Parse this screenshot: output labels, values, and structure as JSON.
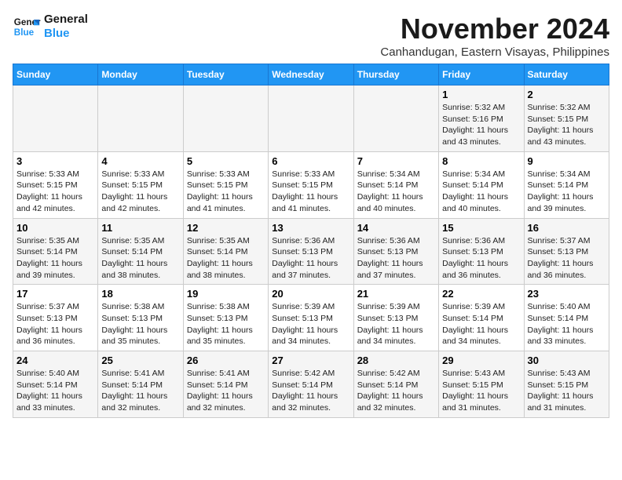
{
  "logo": {
    "line1": "General",
    "line2": "Blue"
  },
  "title": "November 2024",
  "location": "Canhandugan, Eastern Visayas, Philippines",
  "days_of_week": [
    "Sunday",
    "Monday",
    "Tuesday",
    "Wednesday",
    "Thursday",
    "Friday",
    "Saturday"
  ],
  "weeks": [
    [
      {
        "day": "",
        "info": ""
      },
      {
        "day": "",
        "info": ""
      },
      {
        "day": "",
        "info": ""
      },
      {
        "day": "",
        "info": ""
      },
      {
        "day": "",
        "info": ""
      },
      {
        "day": "1",
        "info": "Sunrise: 5:32 AM\nSunset: 5:16 PM\nDaylight: 11 hours\nand 43 minutes."
      },
      {
        "day": "2",
        "info": "Sunrise: 5:32 AM\nSunset: 5:15 PM\nDaylight: 11 hours\nand 43 minutes."
      }
    ],
    [
      {
        "day": "3",
        "info": "Sunrise: 5:33 AM\nSunset: 5:15 PM\nDaylight: 11 hours\nand 42 minutes."
      },
      {
        "day": "4",
        "info": "Sunrise: 5:33 AM\nSunset: 5:15 PM\nDaylight: 11 hours\nand 42 minutes."
      },
      {
        "day": "5",
        "info": "Sunrise: 5:33 AM\nSunset: 5:15 PM\nDaylight: 11 hours\nand 41 minutes."
      },
      {
        "day": "6",
        "info": "Sunrise: 5:33 AM\nSunset: 5:15 PM\nDaylight: 11 hours\nand 41 minutes."
      },
      {
        "day": "7",
        "info": "Sunrise: 5:34 AM\nSunset: 5:14 PM\nDaylight: 11 hours\nand 40 minutes."
      },
      {
        "day": "8",
        "info": "Sunrise: 5:34 AM\nSunset: 5:14 PM\nDaylight: 11 hours\nand 40 minutes."
      },
      {
        "day": "9",
        "info": "Sunrise: 5:34 AM\nSunset: 5:14 PM\nDaylight: 11 hours\nand 39 minutes."
      }
    ],
    [
      {
        "day": "10",
        "info": "Sunrise: 5:35 AM\nSunset: 5:14 PM\nDaylight: 11 hours\nand 39 minutes."
      },
      {
        "day": "11",
        "info": "Sunrise: 5:35 AM\nSunset: 5:14 PM\nDaylight: 11 hours\nand 38 minutes."
      },
      {
        "day": "12",
        "info": "Sunrise: 5:35 AM\nSunset: 5:14 PM\nDaylight: 11 hours\nand 38 minutes."
      },
      {
        "day": "13",
        "info": "Sunrise: 5:36 AM\nSunset: 5:13 PM\nDaylight: 11 hours\nand 37 minutes."
      },
      {
        "day": "14",
        "info": "Sunrise: 5:36 AM\nSunset: 5:13 PM\nDaylight: 11 hours\nand 37 minutes."
      },
      {
        "day": "15",
        "info": "Sunrise: 5:36 AM\nSunset: 5:13 PM\nDaylight: 11 hours\nand 36 minutes."
      },
      {
        "day": "16",
        "info": "Sunrise: 5:37 AM\nSunset: 5:13 PM\nDaylight: 11 hours\nand 36 minutes."
      }
    ],
    [
      {
        "day": "17",
        "info": "Sunrise: 5:37 AM\nSunset: 5:13 PM\nDaylight: 11 hours\nand 36 minutes."
      },
      {
        "day": "18",
        "info": "Sunrise: 5:38 AM\nSunset: 5:13 PM\nDaylight: 11 hours\nand 35 minutes."
      },
      {
        "day": "19",
        "info": "Sunrise: 5:38 AM\nSunset: 5:13 PM\nDaylight: 11 hours\nand 35 minutes."
      },
      {
        "day": "20",
        "info": "Sunrise: 5:39 AM\nSunset: 5:13 PM\nDaylight: 11 hours\nand 34 minutes."
      },
      {
        "day": "21",
        "info": "Sunrise: 5:39 AM\nSunset: 5:13 PM\nDaylight: 11 hours\nand 34 minutes."
      },
      {
        "day": "22",
        "info": "Sunrise: 5:39 AM\nSunset: 5:14 PM\nDaylight: 11 hours\nand 34 minutes."
      },
      {
        "day": "23",
        "info": "Sunrise: 5:40 AM\nSunset: 5:14 PM\nDaylight: 11 hours\nand 33 minutes."
      }
    ],
    [
      {
        "day": "24",
        "info": "Sunrise: 5:40 AM\nSunset: 5:14 PM\nDaylight: 11 hours\nand 33 minutes."
      },
      {
        "day": "25",
        "info": "Sunrise: 5:41 AM\nSunset: 5:14 PM\nDaylight: 11 hours\nand 32 minutes."
      },
      {
        "day": "26",
        "info": "Sunrise: 5:41 AM\nSunset: 5:14 PM\nDaylight: 11 hours\nand 32 minutes."
      },
      {
        "day": "27",
        "info": "Sunrise: 5:42 AM\nSunset: 5:14 PM\nDaylight: 11 hours\nand 32 minutes."
      },
      {
        "day": "28",
        "info": "Sunrise: 5:42 AM\nSunset: 5:14 PM\nDaylight: 11 hours\nand 32 minutes."
      },
      {
        "day": "29",
        "info": "Sunrise: 5:43 AM\nSunset: 5:15 PM\nDaylight: 11 hours\nand 31 minutes."
      },
      {
        "day": "30",
        "info": "Sunrise: 5:43 AM\nSunset: 5:15 PM\nDaylight: 11 hours\nand 31 minutes."
      }
    ]
  ]
}
